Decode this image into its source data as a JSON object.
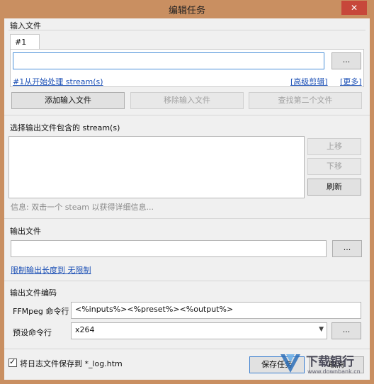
{
  "window": {
    "title": "编辑任务",
    "close_glyph": "✕"
  },
  "input_group": {
    "label": "输入文件",
    "tab_label": "#1",
    "path_value": "",
    "browse_label": "...",
    "stream_link": "#1从开始处理 stream(s)",
    "advanced_link": "[高级剪辑]",
    "more_link": "[更多]",
    "add_button": "添加输入文件",
    "remove_button": "移除输入文件",
    "find_second_button": "查找第二个文件"
  },
  "streams_group": {
    "label": "选择输出文件包含的 stream(s)",
    "up_button": "上移",
    "down_button": "下移",
    "refresh_button": "刷新",
    "info_text": "信息: 双击一个 steam 以获得详细信息..."
  },
  "output_group": {
    "label": "输出文件",
    "path_value": "",
    "browse_label": "...",
    "limit_link": "限制输出长度到 无限制"
  },
  "encoding_group": {
    "label": "输出文件编码",
    "cmd_label": "FFMpeg 命令行",
    "cmd_value": "<%inputs%><%preset%><%output%>",
    "preset_label": "预设命令行",
    "preset_value": "x264",
    "preset_browse": "..."
  },
  "footer": {
    "log_checkbox_label": "将日志文件保存到 *_log.htm",
    "log_checked": true,
    "save_button": "保存任务",
    "cancel_button": "取消"
  },
  "watermark": {
    "brand": "下载银行",
    "url": "www.downbank.cn"
  },
  "colors": {
    "titlebar": "#c98f61",
    "close": "#c7473a",
    "link": "#1b4fb5"
  }
}
